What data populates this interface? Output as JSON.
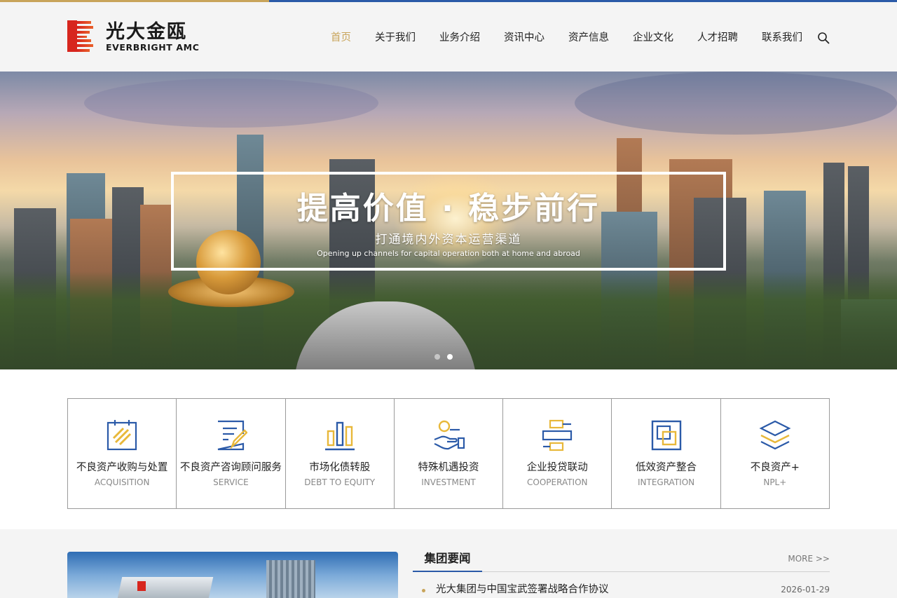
{
  "brand": {
    "name_cn": "光大金瓯",
    "name_en": "EVERBRIGHT AMC",
    "colors": {
      "gold": "#c8a45a",
      "blue": "#2b5aa8",
      "logo_red": "#d7261e"
    }
  },
  "nav": {
    "items": [
      {
        "label": "首页",
        "active": true
      },
      {
        "label": "关于我们"
      },
      {
        "label": "业务介绍"
      },
      {
        "label": "资讯中心"
      },
      {
        "label": "资产信息"
      },
      {
        "label": "企业文化"
      },
      {
        "label": "人才招聘"
      },
      {
        "label": "联系我们"
      }
    ],
    "search_icon": "search-icon"
  },
  "banner": {
    "title": "提高价值 · 稳步前行",
    "subtitle": "打通境内外资本运营渠道",
    "subtitle_en": "Opening up channels for capital operation both at home and abroad",
    "slides": 2,
    "active_slide": 2
  },
  "services": [
    {
      "cn": "不良资产收购与处置",
      "en": "ACQUISITION",
      "icon": "gavel-document-icon"
    },
    {
      "cn": "不良资产咨询顾问服务",
      "en": "SERVICE",
      "icon": "edit-document-icon"
    },
    {
      "cn": "市场化债转股",
      "en": "DEBT TO EQUITY",
      "icon": "bar-chart-icon"
    },
    {
      "cn": "特殊机遇投资",
      "en": "INVESTMENT",
      "icon": "hand-coin-icon"
    },
    {
      "cn": "企业投贷联动",
      "en": "COOPERATION",
      "icon": "linked-blocks-icon"
    },
    {
      "cn": "低效资产整合",
      "en": "INTEGRATION",
      "icon": "overlap-squares-icon"
    },
    {
      "cn": "不良资产+",
      "en": "NPL+",
      "icon": "layers-icon"
    }
  ],
  "news": {
    "title": "集团要闻",
    "more": "MORE >>",
    "items": [
      {
        "text": "光大集团与中国宝武签署战略合作协议",
        "date": "2026-01-29"
      }
    ]
  }
}
